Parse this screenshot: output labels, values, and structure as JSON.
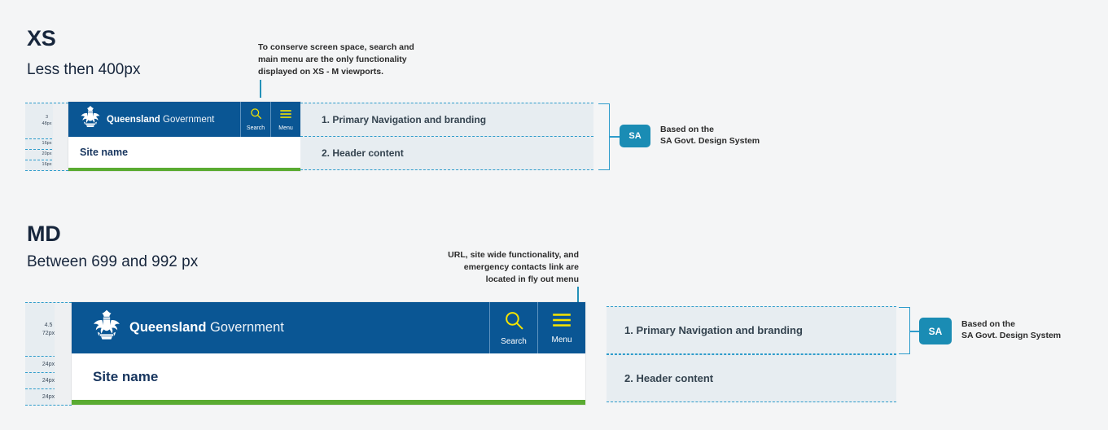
{
  "page": {
    "background": "#f4f5f6",
    "accent_blue": "#0a5694",
    "accent_teal": "#1a8cb4",
    "accent_green": "#5aab32",
    "dashed_border": "#2e9ccb",
    "callout_bg": "#e7edf1",
    "icon_yellow": "#f5e400"
  },
  "sections": [
    {
      "id": "xs",
      "title": "XS",
      "subtitle": "Less then 400px",
      "note": "To conserve screen space, search and\nmain menu are the only functionality\ndisplayed on XS - M viewports.",
      "note_align": "left",
      "ruler_bands": [
        {
          "label": "3\n48px"
        },
        {
          "label": "16px"
        },
        {
          "label": "20px"
        },
        {
          "label": "16px"
        }
      ],
      "navbar": {
        "crest_icon": "queensland-coat-of-arms-icon",
        "brand_bold": "Queensland",
        "brand_light": "Government",
        "actions": [
          {
            "icon": "search-icon",
            "label": "Search"
          },
          {
            "icon": "menu-hamburger-icon",
            "label": "Menu"
          }
        ]
      },
      "sitebar": {
        "site_name": "Site name"
      },
      "callouts": [
        "1. Primary Navigation and branding",
        "2. Header content"
      ],
      "attribution": {
        "badge": "SA",
        "text": "Based on the\nSA Govt. Design System"
      }
    },
    {
      "id": "md",
      "title": "MD",
      "subtitle": "Between 699 and 992 px",
      "note": "URL, site wide functionality, and\nemergency contacts link are\nlocated in fly out menu",
      "note_align": "right",
      "ruler_bands": [
        {
          "label": "4.5\n72px"
        },
        {
          "label": "24px"
        },
        {
          "label": "24px"
        },
        {
          "label": "24px"
        }
      ],
      "navbar": {
        "crest_icon": "queensland-coat-of-arms-icon",
        "brand_bold": "Queensland",
        "brand_light": "Government",
        "actions": [
          {
            "icon": "search-icon",
            "label": "Search"
          },
          {
            "icon": "menu-hamburger-icon",
            "label": "Menu"
          }
        ]
      },
      "sitebar": {
        "site_name": "Site name"
      },
      "callouts": [
        "1. Primary Navigation and branding",
        "2. Header content"
      ],
      "attribution": {
        "badge": "SA",
        "text": "Based on the\nSA Govt. Design System"
      }
    }
  ]
}
